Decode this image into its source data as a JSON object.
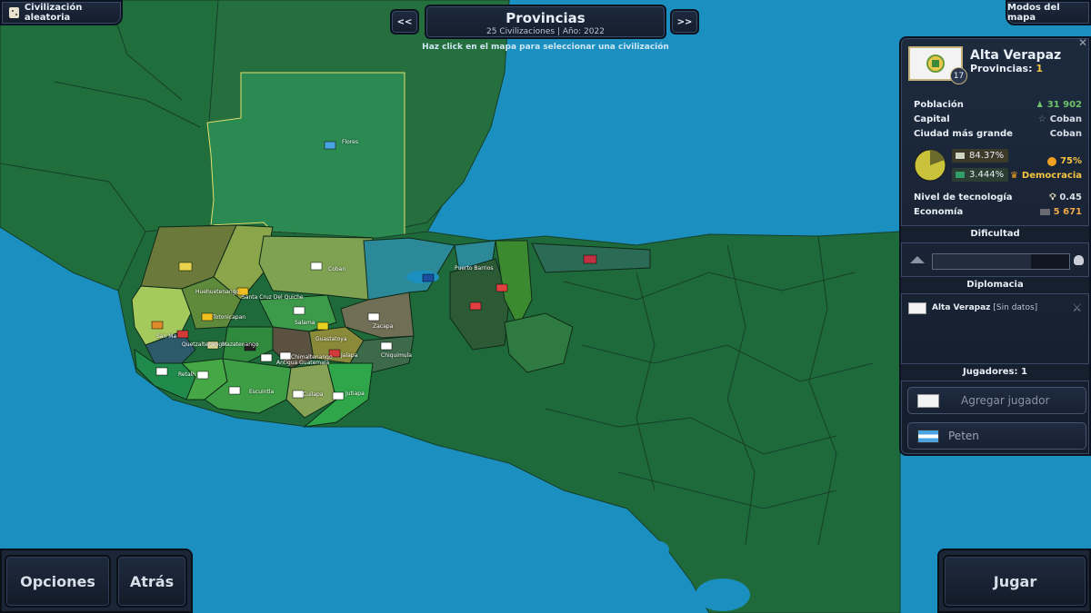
{
  "top_left": {
    "label": "Civilización aleatoria",
    "icon": "dice-icon"
  },
  "top_right": {
    "label": "Modos del mapa"
  },
  "nav": {
    "prev": "<<",
    "next": ">>"
  },
  "title": {
    "main": "Provincias",
    "sub": "25 Civilizaciones | Año: 2022"
  },
  "hint": "Haz click en el mapa para seleccionar una civilización",
  "civ": {
    "name": "Alta Verapaz",
    "provinces_label": "Provincias:",
    "provinces_value": "1",
    "level": "17",
    "population_label": "Población",
    "population_value": "31 902",
    "capital_label": "Capital",
    "capital_value": "Coban",
    "largest_city_label": "Ciudad más grande",
    "largest_city_value": "Coban",
    "stat1": "84.37%",
    "stat2": "3.444%",
    "happiness": "75%",
    "government": "Democracia",
    "tech_label": "Nivel de tecnología",
    "tech_value": "0.45",
    "economy_label": "Economía",
    "economy_value": "5 671"
  },
  "difficulty": {
    "header": "Dificultad",
    "level": 0.72
  },
  "diplomacy": {
    "header": "Diplomacia",
    "entry": "Alta Verapaz",
    "status": "[Sin datos]"
  },
  "players": {
    "header": "Jugadores: 1",
    "add_label": "Agregar jugador",
    "player_name": "Peten"
  },
  "bottom": {
    "options": "Opciones",
    "back": "Atrás",
    "play": "Jugar"
  },
  "map_labels": [
    "Flores",
    "Coban",
    "Huehuetenango",
    "Santa Cruz Del Quiche",
    "Totonicapan",
    "San Ma",
    "Quetzaltenango",
    "Salama",
    "Zacapa",
    "Guastatoya",
    "Jalapa",
    "Chiquimula",
    "Retalh",
    "Mazatenango",
    "Escuintla",
    "Cuilapa",
    "Jutiapa",
    "Puerto Barrios",
    "Chimaltenango",
    "Antigua Guatemala"
  ],
  "colors": {
    "accent_gold": "#f5c542",
    "green_stat": "#6fc36a",
    "economy": "#f0a94a",
    "sea": "#1b8fc0"
  }
}
